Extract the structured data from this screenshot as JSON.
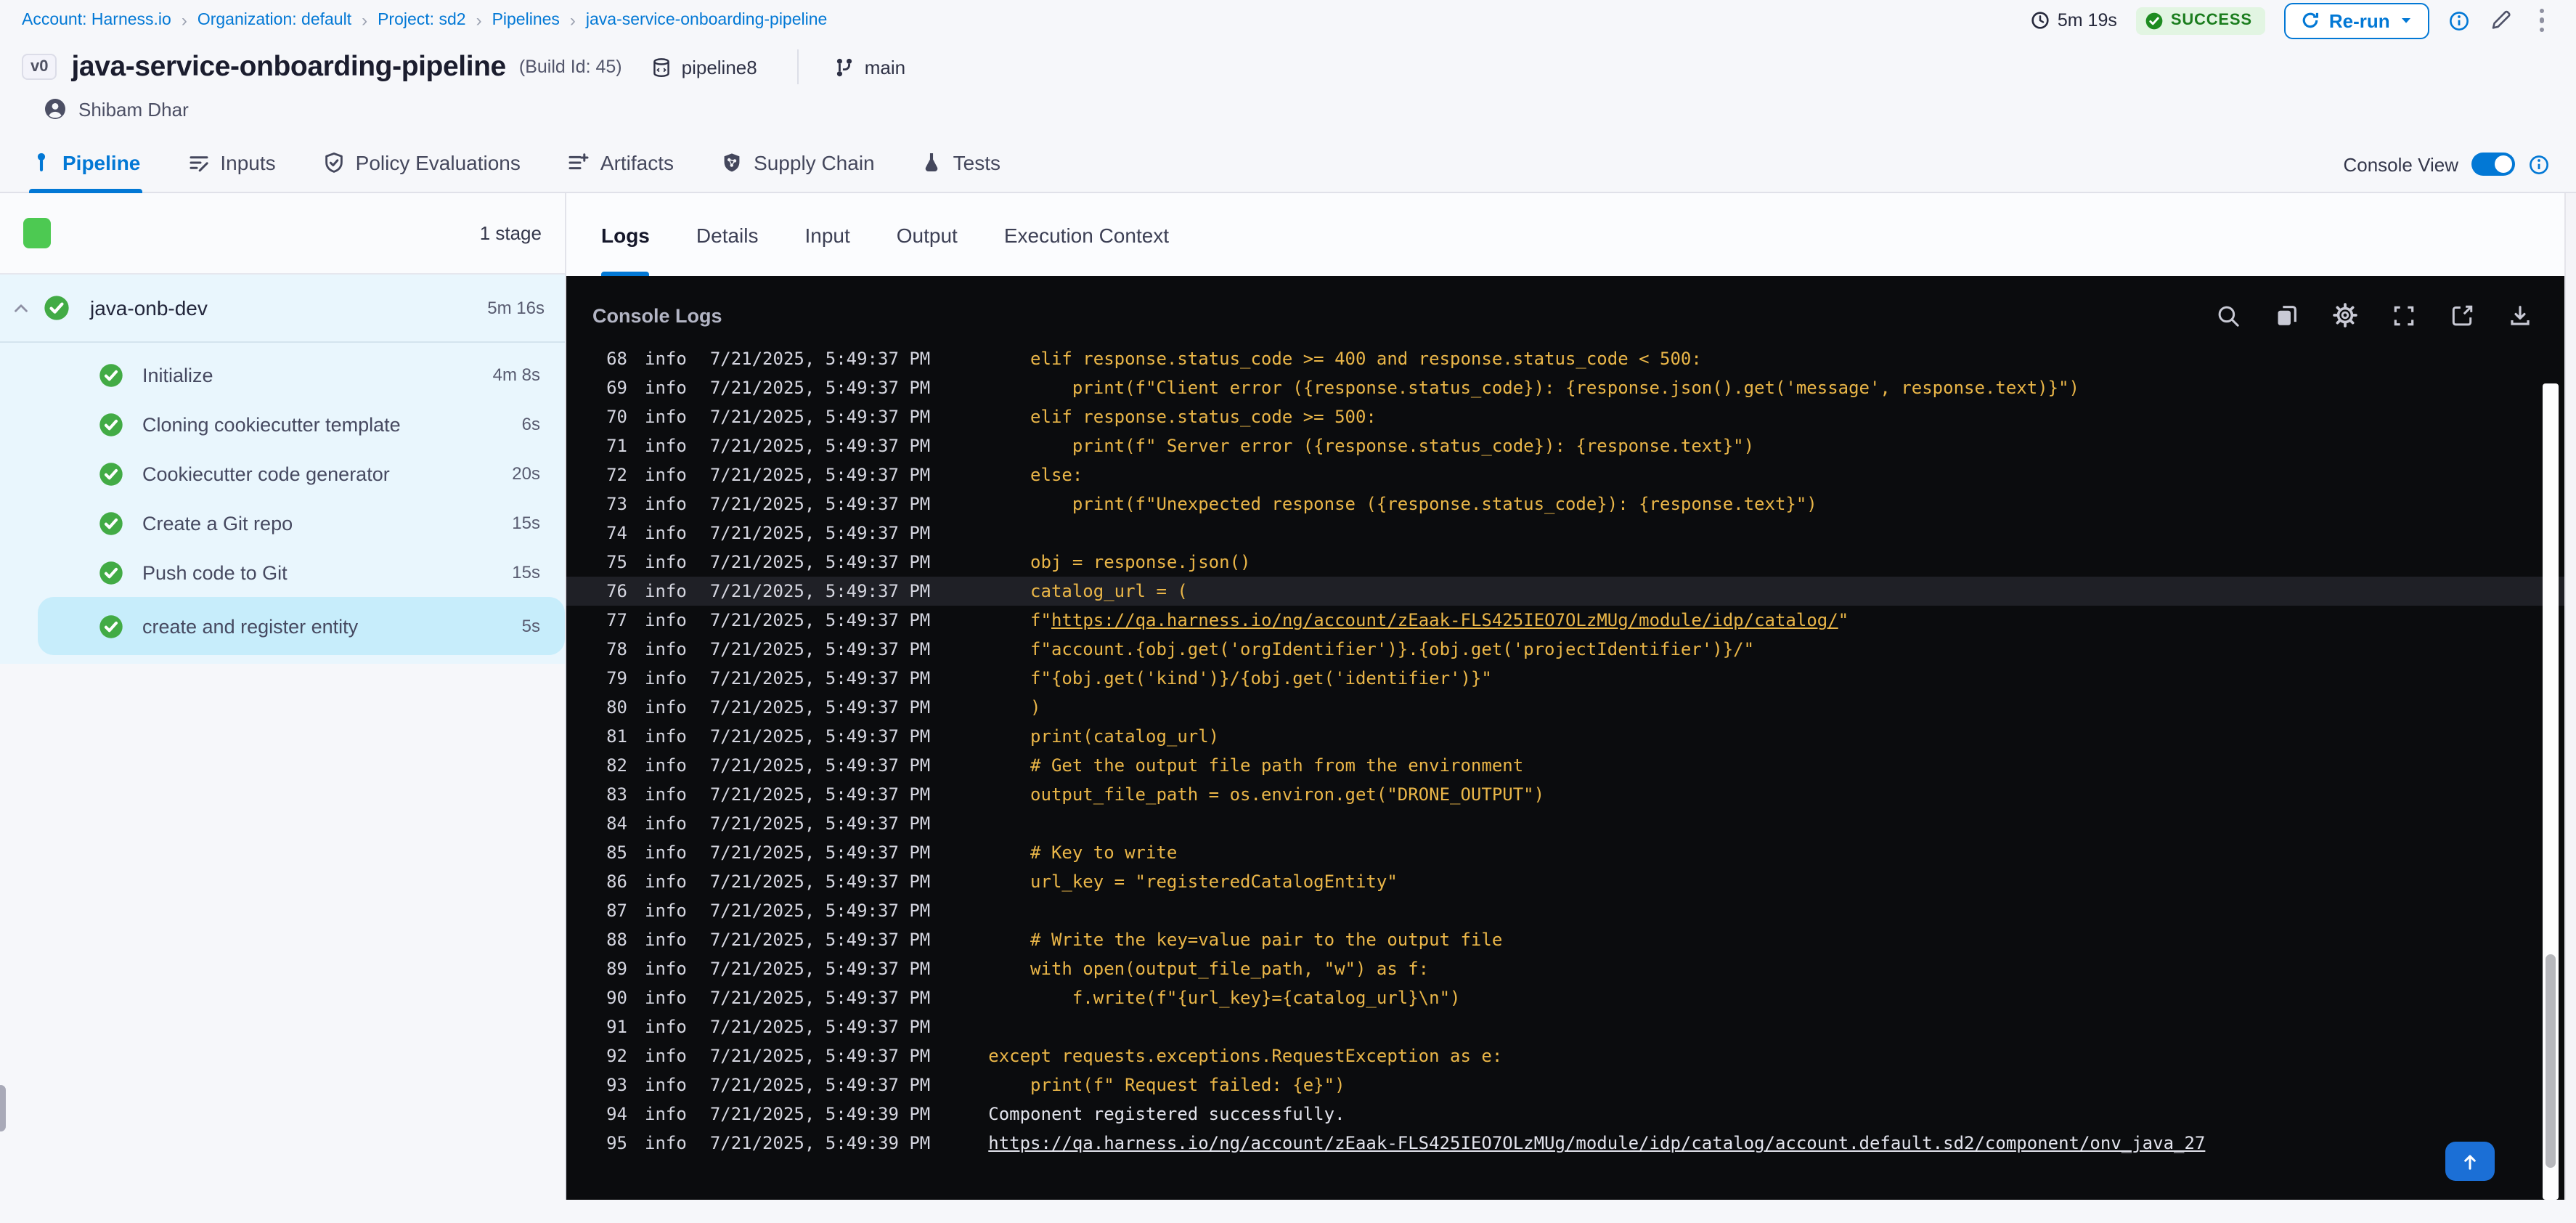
{
  "colors": {
    "accent": "#0278d5",
    "success_green": "#42ab45",
    "stage_green": "#4dc952",
    "code_yellow": "#eab648",
    "console_bg": "#0b0c0e",
    "selected_step_bg": "#c7edfb"
  },
  "breadcrumb": [
    "Account: Harness.io",
    "Organization: default",
    "Project: sd2",
    "Pipelines",
    "java-service-onboarding-pipeline"
  ],
  "header": {
    "duration": "5m 19s",
    "status": "SUCCESS",
    "rerun": "Re-run",
    "version_badge": "v0",
    "pipeline_name": "java-service-onboarding-pipeline",
    "build_id": "(Build Id: 45)",
    "repo": "pipeline8",
    "branch": "main",
    "user": "Shibam Dhar"
  },
  "tabs": [
    {
      "label": "Pipeline",
      "icon": "pipeline",
      "active": true
    },
    {
      "label": "Inputs",
      "icon": "inputs",
      "active": false
    },
    {
      "label": "Policy Evaluations",
      "icon": "policy",
      "active": false
    },
    {
      "label": "Artifacts",
      "icon": "artifacts",
      "active": false
    },
    {
      "label": "Supply Chain",
      "icon": "supply-chain",
      "active": false
    },
    {
      "label": "Tests",
      "icon": "tests",
      "active": false
    }
  ],
  "console_view": {
    "label": "Console View",
    "enabled": true
  },
  "sidebar": {
    "stage_count": "1 stage",
    "stage": {
      "name": "java-onb-dev",
      "duration": "5m 16s"
    },
    "steps": [
      {
        "name": "Initialize",
        "duration": "4m 8s",
        "selected": false
      },
      {
        "name": "Cloning cookiecutter template",
        "duration": "6s",
        "selected": false
      },
      {
        "name": "Cookiecutter code generator",
        "duration": "20s",
        "selected": false
      },
      {
        "name": "Create a Git repo",
        "duration": "15s",
        "selected": false
      },
      {
        "name": "Push code to Git",
        "duration": "15s",
        "selected": false
      },
      {
        "name": "create and register entity",
        "duration": "5s",
        "selected": true
      }
    ]
  },
  "log_tabs": [
    {
      "label": "Logs",
      "active": true
    },
    {
      "label": "Details",
      "active": false
    },
    {
      "label": "Input",
      "active": false
    },
    {
      "label": "Output",
      "active": false
    },
    {
      "label": "Execution Context",
      "active": false
    }
  ],
  "console": {
    "title": "Console Logs",
    "toolbar": [
      "search",
      "copy",
      "settings",
      "fullscreen",
      "open-new",
      "download"
    ]
  },
  "logs": [
    {
      "n": 68,
      "level": "info",
      "time": "7/21/2025, 5:49:37 PM",
      "style": "code",
      "text": "    elif response.status_code >= 400 and response.status_code < 500:"
    },
    {
      "n": 69,
      "level": "info",
      "time": "7/21/2025, 5:49:37 PM",
      "style": "code",
      "text": "        print(f\"Client error ({response.status_code}): {response.json().get('message', response.text)}\")"
    },
    {
      "n": 70,
      "level": "info",
      "time": "7/21/2025, 5:49:37 PM",
      "style": "code",
      "text": "    elif response.status_code >= 500:"
    },
    {
      "n": 71,
      "level": "info",
      "time": "7/21/2025, 5:49:37 PM",
      "style": "code",
      "text": "        print(f\" Server error ({response.status_code}): {response.text}\")"
    },
    {
      "n": 72,
      "level": "info",
      "time": "7/21/2025, 5:49:37 PM",
      "style": "code",
      "text": "    else:"
    },
    {
      "n": 73,
      "level": "info",
      "time": "7/21/2025, 5:49:37 PM",
      "style": "code",
      "text": "        print(f\"Unexpected response ({response.status_code}): {response.text}\")"
    },
    {
      "n": 74,
      "level": "info",
      "time": "7/21/2025, 5:49:37 PM",
      "style": "code",
      "text": ""
    },
    {
      "n": 75,
      "level": "info",
      "time": "7/21/2025, 5:49:37 PM",
      "style": "code",
      "text": "    obj = response.json()"
    },
    {
      "n": 76,
      "level": "info",
      "time": "7/21/2025, 5:49:37 PM",
      "style": "code",
      "text": "    catalog_url = (",
      "highlight": true
    },
    {
      "n": 77,
      "level": "info",
      "time": "7/21/2025, 5:49:37 PM",
      "style": "code",
      "prefix": "    f\"",
      "link": "https://qa.harness.io/ng/account/zEaak-FLS425IEO7OLzMUg/module/idp/catalog/",
      "suffix": "\""
    },
    {
      "n": 78,
      "level": "info",
      "time": "7/21/2025, 5:49:37 PM",
      "style": "code",
      "text": "    f\"account.{obj.get('orgIdentifier')}.{obj.get('projectIdentifier')}/\""
    },
    {
      "n": 79,
      "level": "info",
      "time": "7/21/2025, 5:49:37 PM",
      "style": "code",
      "text": "    f\"{obj.get('kind')}/{obj.get('identifier')}\""
    },
    {
      "n": 80,
      "level": "info",
      "time": "7/21/2025, 5:49:37 PM",
      "style": "code",
      "text": "    )"
    },
    {
      "n": 81,
      "level": "info",
      "time": "7/21/2025, 5:49:37 PM",
      "style": "code",
      "text": "    print(catalog_url)"
    },
    {
      "n": 82,
      "level": "info",
      "time": "7/21/2025, 5:49:37 PM",
      "style": "code",
      "text": "    # Get the output file path from the environment"
    },
    {
      "n": 83,
      "level": "info",
      "time": "7/21/2025, 5:49:37 PM",
      "style": "code",
      "text": "    output_file_path = os.environ.get(\"DRONE_OUTPUT\")"
    },
    {
      "n": 84,
      "level": "info",
      "time": "7/21/2025, 5:49:37 PM",
      "style": "code",
      "text": ""
    },
    {
      "n": 85,
      "level": "info",
      "time": "7/21/2025, 5:49:37 PM",
      "style": "code",
      "text": "    # Key to write"
    },
    {
      "n": 86,
      "level": "info",
      "time": "7/21/2025, 5:49:37 PM",
      "style": "code",
      "text": "    url_key = \"registeredCatalogEntity\""
    },
    {
      "n": 87,
      "level": "info",
      "time": "7/21/2025, 5:49:37 PM",
      "style": "code",
      "text": ""
    },
    {
      "n": 88,
      "level": "info",
      "time": "7/21/2025, 5:49:37 PM",
      "style": "code",
      "text": "    # Write the key=value pair to the output file"
    },
    {
      "n": 89,
      "level": "info",
      "time": "7/21/2025, 5:49:37 PM",
      "style": "code",
      "text": "    with open(output_file_path, \"w\") as f:"
    },
    {
      "n": 90,
      "level": "info",
      "time": "7/21/2025, 5:49:37 PM",
      "style": "code",
      "text": "        f.write(f\"{url_key}={catalog_url}\\n\")"
    },
    {
      "n": 91,
      "level": "info",
      "time": "7/21/2025, 5:49:37 PM",
      "style": "code",
      "text": ""
    },
    {
      "n": 92,
      "level": "info",
      "time": "7/21/2025, 5:49:37 PM",
      "style": "code",
      "text": "except requests.exceptions.RequestException as e:"
    },
    {
      "n": 93,
      "level": "info",
      "time": "7/21/2025, 5:49:37 PM",
      "style": "code",
      "text": "    print(f\" Request failed: {e}\")"
    },
    {
      "n": 94,
      "level": "info",
      "time": "7/21/2025, 5:49:39 PM",
      "style": "out",
      "text": "Component registered successfully."
    },
    {
      "n": 95,
      "level": "info",
      "time": "7/21/2025, 5:49:39 PM",
      "style": "out",
      "link": "https://qa.harness.io/ng/account/zEaak-FLS425IEO7OLzMUg/module/idp/catalog/account.default.sd2/component/onv_java_27"
    }
  ]
}
